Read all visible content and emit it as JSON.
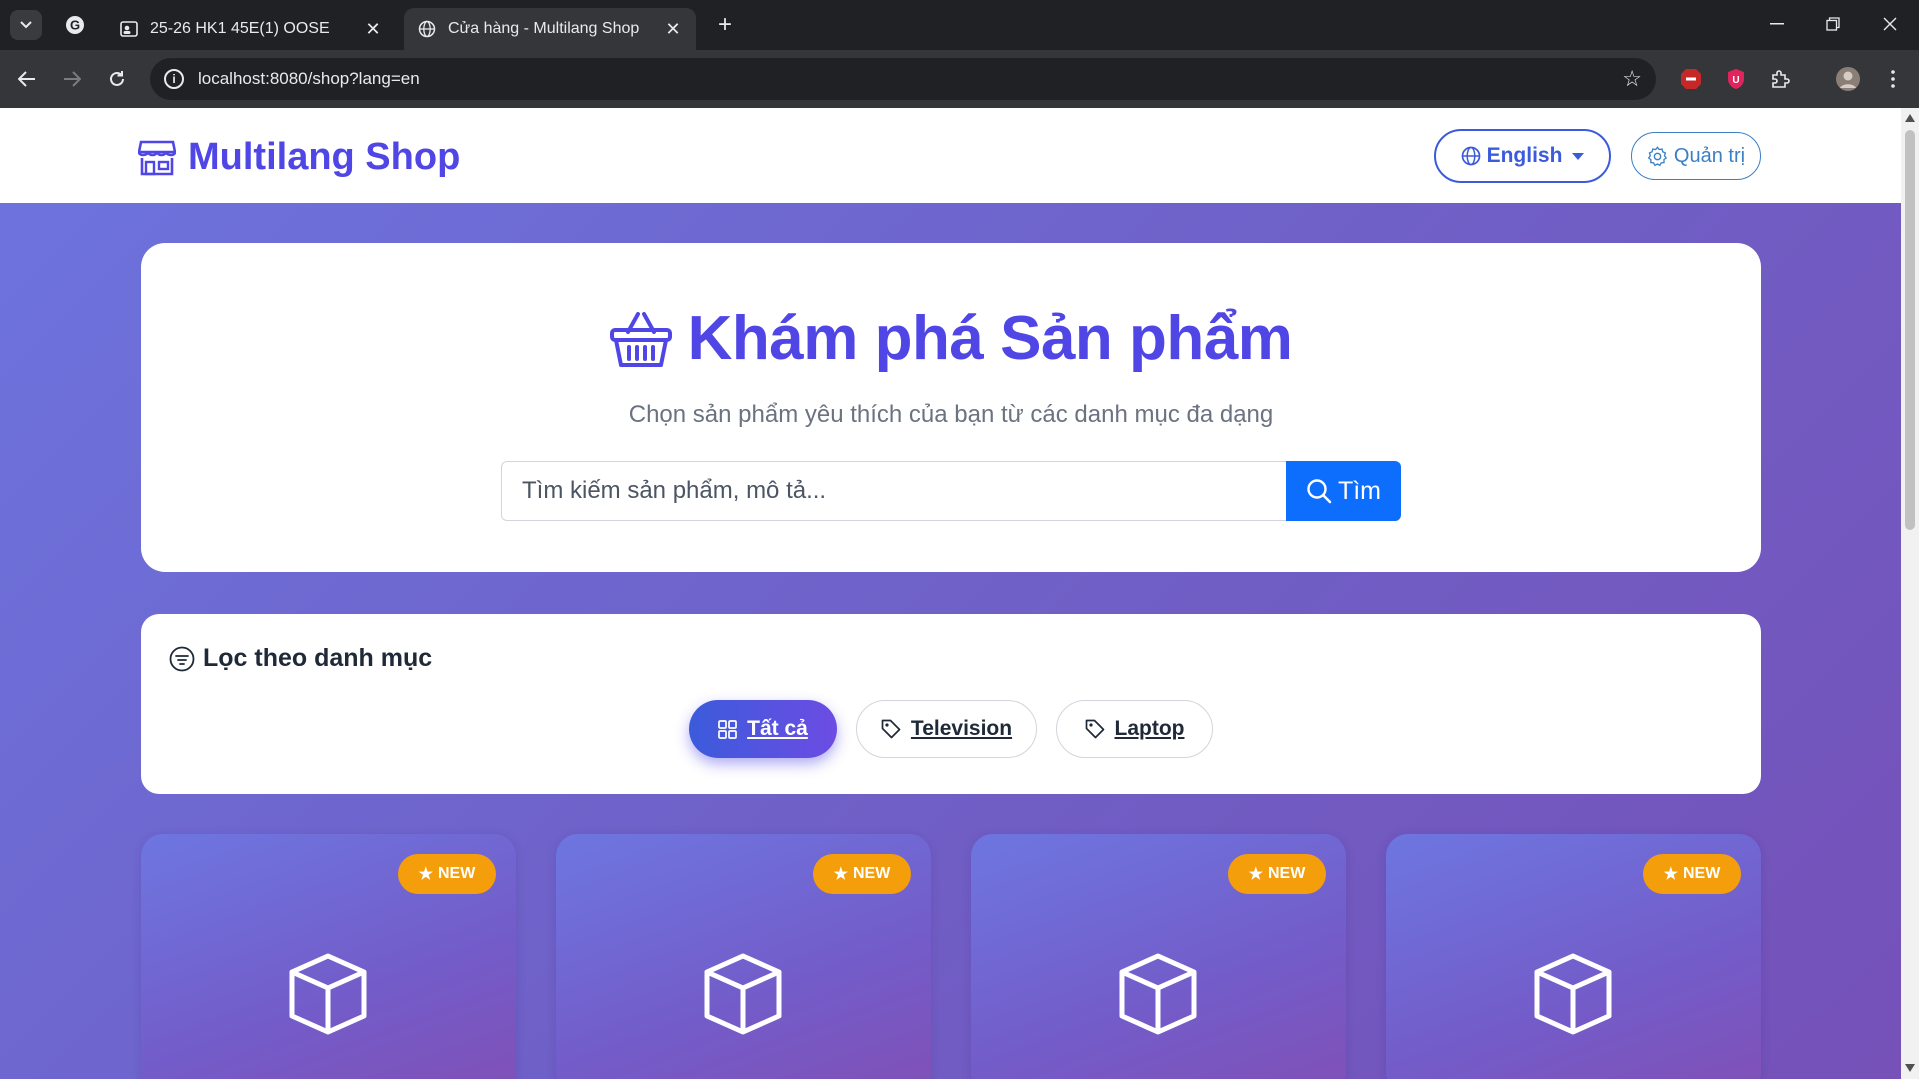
{
  "browser": {
    "tabs": [
      {
        "title": "25-26 HK1 45E(1) OOSE",
        "active": false
      },
      {
        "title": "Cửa hàng - Multilang Shop",
        "active": true
      }
    ],
    "url": "localhost:8080/shop?lang=en"
  },
  "header": {
    "brand": "Multilang Shop",
    "language_label": "English",
    "admin_label": "Quản trị"
  },
  "hero": {
    "title": "Khám phá Sản phẩm",
    "subtitle": "Chọn sản phẩm yêu thích của bạn từ các danh mục đa dạng",
    "search_placeholder": "Tìm kiếm sản phẩm, mô tả...",
    "search_button": "Tìm"
  },
  "filter": {
    "heading": "Lọc theo danh mục",
    "categories": [
      {
        "label": "Tất cả",
        "active": true
      },
      {
        "label": "Television",
        "active": false
      },
      {
        "label": "Laptop",
        "active": false
      }
    ]
  },
  "products": [
    {
      "badge": "NEW"
    },
    {
      "badge": "NEW"
    },
    {
      "badge": "NEW"
    },
    {
      "badge": "NEW"
    }
  ],
  "colors": {
    "brand": "#4f46e5",
    "primary": "#0d6efd",
    "badge": "#f59e0b"
  }
}
